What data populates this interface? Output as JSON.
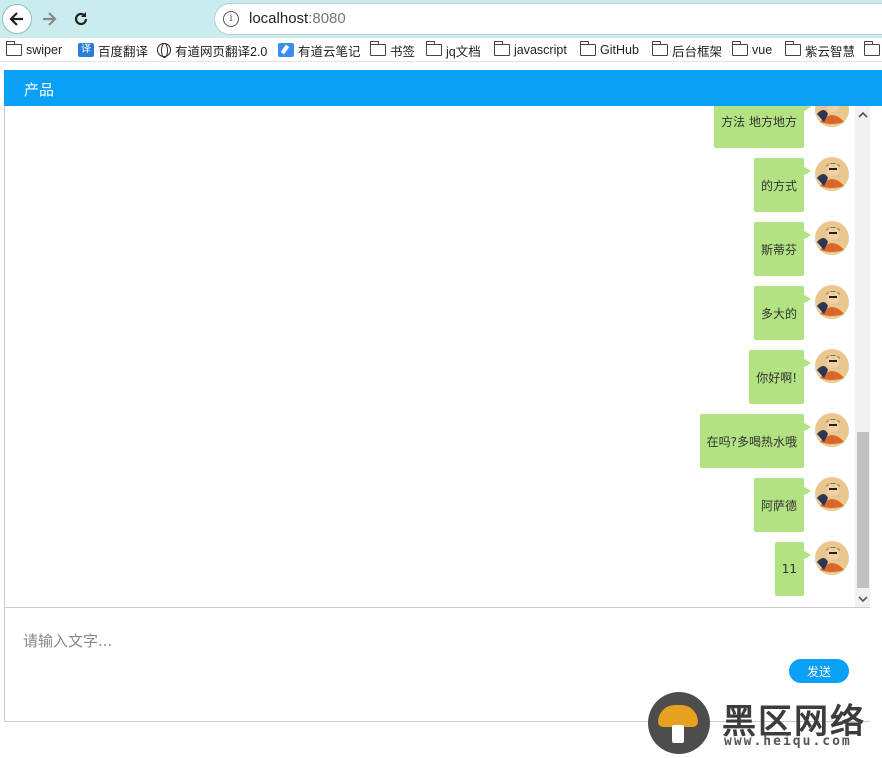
{
  "browser": {
    "url_host": "localhost",
    "url_port": ":8080",
    "back_icon": "arrow-left-icon",
    "forward_icon": "arrow-right-icon",
    "reload_icon": "reload-icon",
    "info_icon": "info-icon"
  },
  "bookmarks": [
    {
      "label": "swiper",
      "icon": "folder-icon"
    },
    {
      "label": "百度翻译",
      "icon": "translate-icon"
    },
    {
      "label": "有道网页翻译2.0",
      "icon": "globe-icon"
    },
    {
      "label": "有道云笔记",
      "icon": "note-icon"
    },
    {
      "label": "书签",
      "icon": "folder-icon"
    },
    {
      "label": "jq文档",
      "icon": "folder-icon"
    },
    {
      "label": "javascript",
      "icon": "folder-icon"
    },
    {
      "label": "GitHub",
      "icon": "folder-icon"
    },
    {
      "label": "后台框架",
      "icon": "folder-icon"
    },
    {
      "label": "vue",
      "icon": "folder-icon"
    },
    {
      "label": "紫云智慧",
      "icon": "folder-icon"
    }
  ],
  "bookmark_icon_glyph": "译",
  "chat": {
    "title": "产品",
    "messages": [
      {
        "text": "方法 地方地方"
      },
      {
        "text": "的方式"
      },
      {
        "text": "斯蒂芬"
      },
      {
        "text": "多大的"
      },
      {
        "text": "你好啊!"
      },
      {
        "text": "在吗?多喝热水哦"
      },
      {
        "text": "阿萨德"
      },
      {
        "text": "11"
      }
    ],
    "input_placeholder": "请输入文字...",
    "input_value": "",
    "send_label": "发送"
  },
  "watermark": {
    "text": "黑区网络",
    "sub": "www.heiqu.com"
  },
  "colors": {
    "header": "#0aa0f5",
    "bubble": "#b2e281",
    "browser_bar": "#c9ecef"
  }
}
